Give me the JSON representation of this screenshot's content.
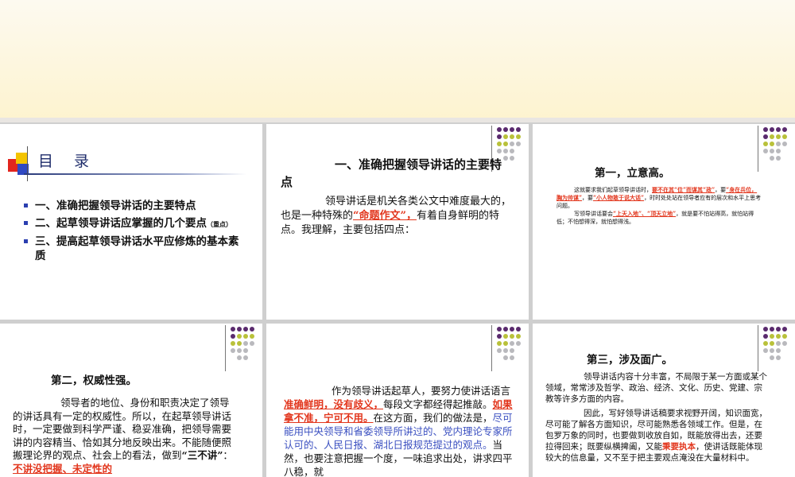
{
  "slide1": {
    "title": "目 录",
    "items": [
      {
        "text": "一、准确把握领导讲话的主要特点",
        "note": ""
      },
      {
        "text": "二、起草领导讲话应掌握的几个要点",
        "note": "（重点）"
      },
      {
        "text": "三、提高起草领导讲话水平应修炼的基本素质",
        "note": ""
      }
    ]
  },
  "slide2": {
    "heading": "一、准确把握领导讲话的主要特点",
    "p_a": "领导讲话是机关各类公文中难度最大的，也是一种特殊的",
    "p_red": "“命题作文”，",
    "p_b": "有着自身鲜明的特点。我理解，主要包括四点："
  },
  "slide3": {
    "heading": "第一，立意高。",
    "p1_a": "这就要求我们起草领导讲话时，",
    "p1_r1": "要不在其“位”而谋其“政”",
    "p1_b": "，要",
    "p1_r2": "“身在兵位，胸为帅谋”",
    "p1_c": "，要",
    "p1_r3": "“小人物敢于说大话”",
    "p1_d": "，时时处处站在领导者应有的层次和水平上思考问题。",
    "p2_a": "写领导讲话要会",
    "p2_r1": "“上天入地”、“顶天立地”",
    "p2_b": "，就是要不怕站得高，就怕站得低；不怕想得深，就怕想得浅。"
  },
  "slide4": {
    "heading": "第二，权威性强。",
    "p_a": "领导者的地位、身份和职责决定了领导的讲话具有一定的权威性。所以，在起草领导讲话时，一定要做到科学严谨、稳妥准确，把领导需要讲的内容精当、恰如其分地反映出来。不能随便照搬理论界的观点、社会上的看法，做到",
    "p_bold": "“三不讲”",
    "p_colon": "：",
    "p_redu": "不讲没把握、未定性的"
  },
  "slide5": {
    "p_a": "作为领导讲话起草人，要努力使讲话语言",
    "p_redu1": "准确鲜明，没有歧义，",
    "p_b": "每段文字都经得起推敲。",
    "p_redu2": "如果拿不准，宁可不用。",
    "p_c": "在这方面，我们的做法是，",
    "p_blue": "尽可能用中央领导和省委领导所讲过的、党内理论专家所认可的、人民日报、湖北日报规范提过的观点。",
    "p_d": "当然，也要注意把握一个度，一味追求出处，讲求四平八稳，就"
  },
  "slide6": {
    "heading": "第三，涉及面广。",
    "p1": "领导讲话内容十分丰富，不局限于某一方面或某个领域，常常涉及哲学、政治、经济、文化、历史、党建、宗教等许多方面的内容。",
    "p2_a": "因此，写好领导讲话稿要求视野开阔，知识面宽，尽可能了解各方面知识，尽可能熟悉各领域工作。但是，在包罗万象的同时，也要做到收放自如，既能放得出去，还要拉得回来；既要纵横捭阖，又能",
    "p2_red": "秉要执本",
    "p2_b": "，使讲话既能体现较大的信息量，又不至于把主要观点淹没在大量材料中。"
  },
  "colors": {
    "purple": "#5a2a6e",
    "olive": "#b9c13a",
    "gray": "#b9b9bd",
    "heading_blue": "#1f2d6b",
    "emphasis_red": "#e2361d"
  }
}
